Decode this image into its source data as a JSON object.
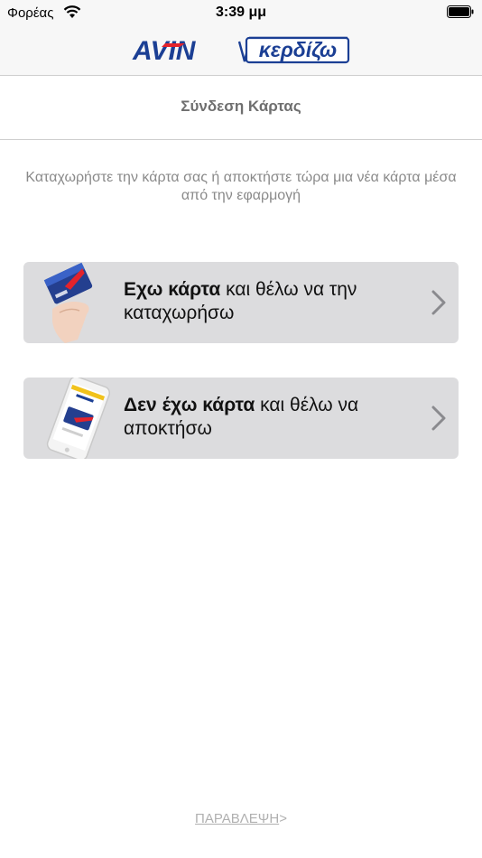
{
  "status_bar": {
    "carrier": "Φορέας",
    "time": "3:39 μμ",
    "icons": [
      "wifi-icon",
      "battery-icon"
    ]
  },
  "header": {
    "logo_brand": "AVIN",
    "logo_word": "κερδίζω"
  },
  "page": {
    "title": "Σύνδεση Κάρτας",
    "intro": "Καταχωρήστε την κάρτα σας ή αποκτήστε τώρα μια νέα κάρτα μέσα από την εφαρμογή"
  },
  "options": [
    {
      "bold": "Εχω κάρτα",
      "rest": " και θέλω να την καταχωρήσω",
      "icon": "hand-holding-card-icon"
    },
    {
      "bold": "Δεν έχω κάρτα",
      "rest": " και θέλω να αποκτήσω",
      "icon": "phone-app-icon"
    }
  ],
  "footer": {
    "skip_label": "ΠΑΡΑΒΛΕΨΗ",
    "skip_arrow": ">"
  },
  "colors": {
    "card_bg": "#dcdcde",
    "brand_blue": "#1b3f94",
    "brand_red": "#e3232b",
    "muted_text": "#8a8a8a"
  }
}
